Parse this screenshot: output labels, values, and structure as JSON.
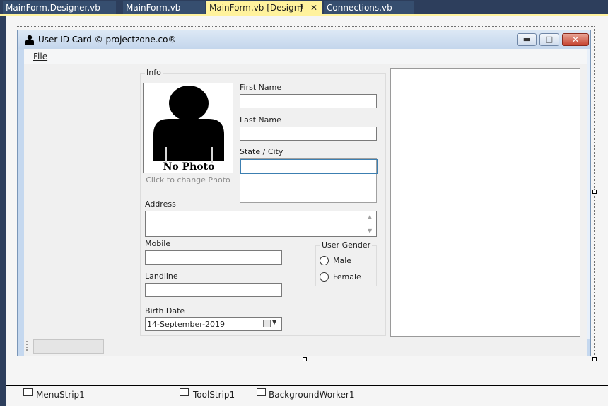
{
  "tabs": [
    {
      "label": "MainForm.Designer.vb"
    },
    {
      "label": "MainForm.vb"
    },
    {
      "label": "MainForm.vb [Design]",
      "active": true
    },
    {
      "label": "Connections.vb"
    }
  ],
  "tab_icons": {
    "pin": "pin-icon",
    "close": "close-icon"
  },
  "form": {
    "title": "User ID Card © projectzone.co®",
    "title_icon": "user-icon",
    "menu": {
      "file": "File"
    },
    "info_group": {
      "legend": "Info",
      "photo_caption": "No Photo",
      "photo_hint": "Click to change Photo",
      "first_name_label": "First Name",
      "first_name_value": "",
      "last_name_label": "Last Name",
      "last_name_value": "",
      "state_city_label": "State / City",
      "address_label": "Address",
      "mobile_label": "Mobile",
      "landline_label": "Landline",
      "birth_date_label": "Birth Date",
      "birth_date_value": "14-September-2019"
    },
    "gender_group": {
      "legend": "User Gender",
      "options": [
        "Male",
        "Female"
      ]
    }
  },
  "tray": [
    {
      "label": "MenuStrip1",
      "icon": "menustrip-icon"
    },
    {
      "label": "ToolStrip1",
      "icon": "toolstrip-icon"
    },
    {
      "label": "BackgroundWorker1",
      "icon": "backgroundworker-icon"
    }
  ],
  "colors": {
    "ide_background": "#2d3e5c",
    "active_tab": "#fff29d",
    "designer_surface": "#f5f5f5",
    "form_frame": "#c5d8ef",
    "close_button": "#c7432f"
  }
}
